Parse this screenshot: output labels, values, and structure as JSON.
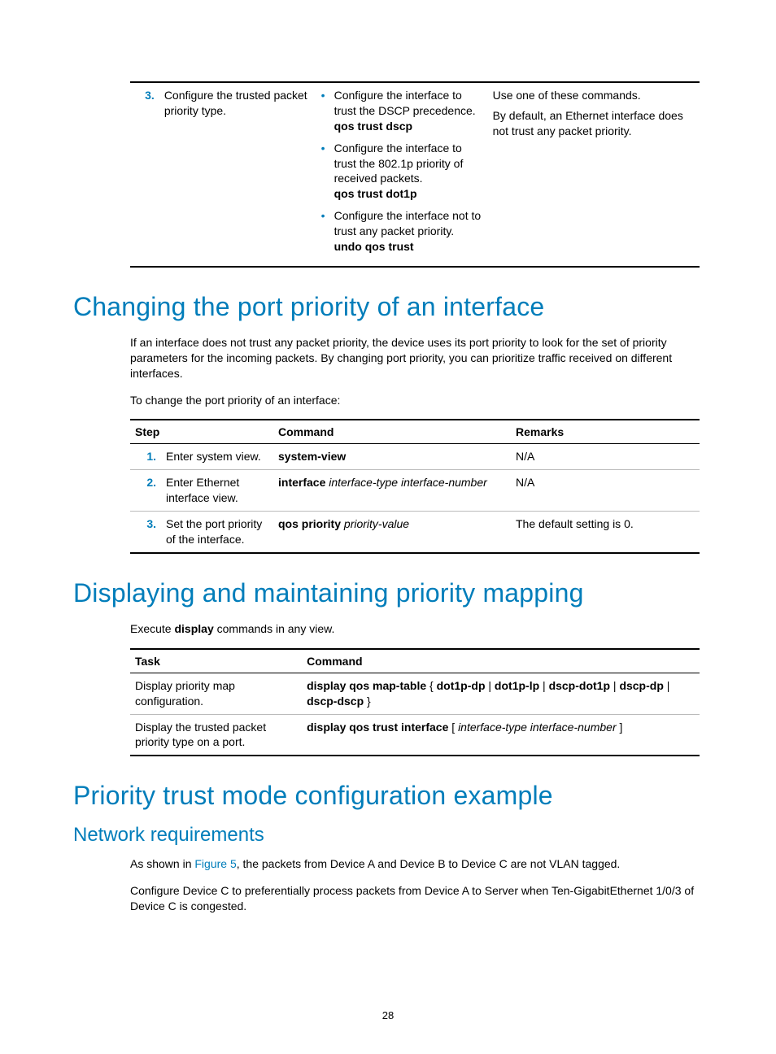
{
  "table1": {
    "row3": {
      "num": "3.",
      "step": "Configure the trusted packet priority type.",
      "li1_desc": "Configure the interface to trust the DSCP precedence.",
      "li1_cmd": "qos trust dscp",
      "li2_desc": "Configure the interface to trust the 802.1p priority of received packets.",
      "li2_cmd": "qos trust dot1p",
      "li3_desc": "Configure the interface not to trust any packet priority.",
      "li3_cmd": "undo qos trust",
      "rem1": "Use one of these commands.",
      "rem2": "By default, an Ethernet interface does not trust any packet priority."
    }
  },
  "h1_changing": "Changing the port priority of an interface",
  "p_changing_intro": "If an interface does not trust any packet priority, the device uses its port priority to look for the set of priority parameters for the incoming packets. By changing port priority, you can prioritize traffic received on different interfaces.",
  "p_changing_lead": "To change the port priority of an interface:",
  "table2": {
    "headers": {
      "step": "Step",
      "cmd": "Command",
      "rem": "Remarks"
    },
    "r1": {
      "num": "1.",
      "step": "Enter system view.",
      "cmd_b": "system-view",
      "rem": "N/A"
    },
    "r2": {
      "num": "2.",
      "step": "Enter Ethernet interface view.",
      "cmd_b": "interface",
      "cmd_i": " interface-type interface-number",
      "rem": "N/A"
    },
    "r3": {
      "num": "3.",
      "step": "Set the port priority of the interface.",
      "cmd_b": "qos priority",
      "cmd_i": " priority-value",
      "rem": "The default setting is 0."
    }
  },
  "h1_display": "Displaying and maintaining priority mapping",
  "p_display_lead_pre": "Execute ",
  "p_display_lead_b": "display",
  "p_display_lead_post": " commands in any view.",
  "table3": {
    "headers": {
      "task": "Task",
      "cmd": "Command"
    },
    "r1": {
      "task": "Display priority map configuration.",
      "cmd_b": "display qos map-table",
      "cmd_rest": " { ",
      "opt1": "dot1p-dp",
      "sep": " | ",
      "opt2": "dot1p-lp",
      "opt3": "dscp-dot1p",
      "opt4": "dscp-dp",
      "opt5": "dscp-dscp",
      "close": " }"
    },
    "r2": {
      "task": "Display the trusted packet priority type on a port.",
      "cmd_b": "display qos trust interface",
      "open": " [ ",
      "cmd_i": "interface-type interface-number",
      "close": " ]"
    }
  },
  "h1_example": "Priority trust mode configuration example",
  "h2_netreq": "Network requirements",
  "p_netreq_pre": "As shown in ",
  "p_netreq_link": "Figure 5",
  "p_netreq_post": ", the packets from Device A and Device B to Device C are not VLAN tagged.",
  "p_netreq2": "Configure Device C to preferentially process packets from Device A to Server when Ten-GigabitEthernet 1/0/3 of Device C is congested.",
  "page_number": "28"
}
